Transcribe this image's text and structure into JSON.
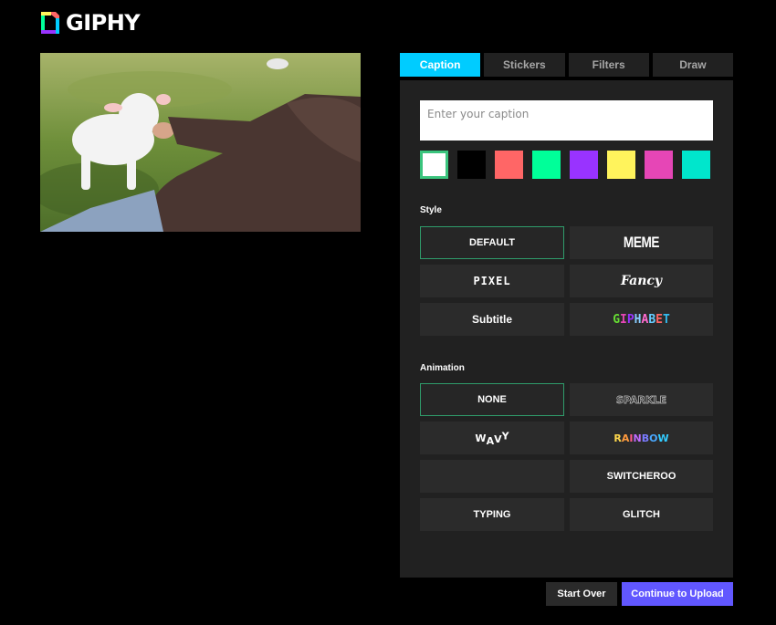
{
  "header": {
    "logo_text": "GIPHY"
  },
  "preview": {
    "description": "video frame of a white lamb in a grassy field next to a person in a brown hoodie"
  },
  "tabs": [
    {
      "label": "Caption",
      "active": true
    },
    {
      "label": "Stickers",
      "active": false
    },
    {
      "label": "Filters",
      "active": false
    },
    {
      "label": "Draw",
      "active": false
    }
  ],
  "caption": {
    "value": "",
    "placeholder": "Enter your caption"
  },
  "colors": {
    "selected_index": 0,
    "swatches": [
      "#ffffff",
      "#000000",
      "#ff6666",
      "#00ff99",
      "#9933ff",
      "#fff35c",
      "#e646b6",
      "#00e6cc"
    ]
  },
  "style": {
    "label": "Style",
    "options": [
      {
        "label": "DEFAULT",
        "selected": true
      },
      {
        "label": "MEME",
        "selected": false
      },
      {
        "label": "PIXEL",
        "selected": false
      },
      {
        "label": "Fancy",
        "selected": false
      },
      {
        "label": "Subtitle",
        "selected": false
      },
      {
        "label": "GIPHABET",
        "selected": false
      }
    ]
  },
  "animation": {
    "label": "Animation",
    "options": [
      {
        "label": "NONE",
        "selected": true
      },
      {
        "label": "SPARKLE",
        "selected": false
      },
      {
        "label": "WAVY",
        "selected": false
      },
      {
        "label": "RAINBOW",
        "selected": false
      },
      {
        "label": "",
        "selected": false
      },
      {
        "label": "SWITCHEROO",
        "selected": false
      },
      {
        "label": "TYPING",
        "selected": false
      },
      {
        "label": "GLITCH",
        "selected": false
      }
    ]
  },
  "footer": {
    "start_over_label": "Start Over",
    "continue_label": "Continue to Upload"
  },
  "theme": {
    "accent": "#00ccff",
    "primary_button": "#6157ff",
    "selected_border": "#3ac47d"
  }
}
